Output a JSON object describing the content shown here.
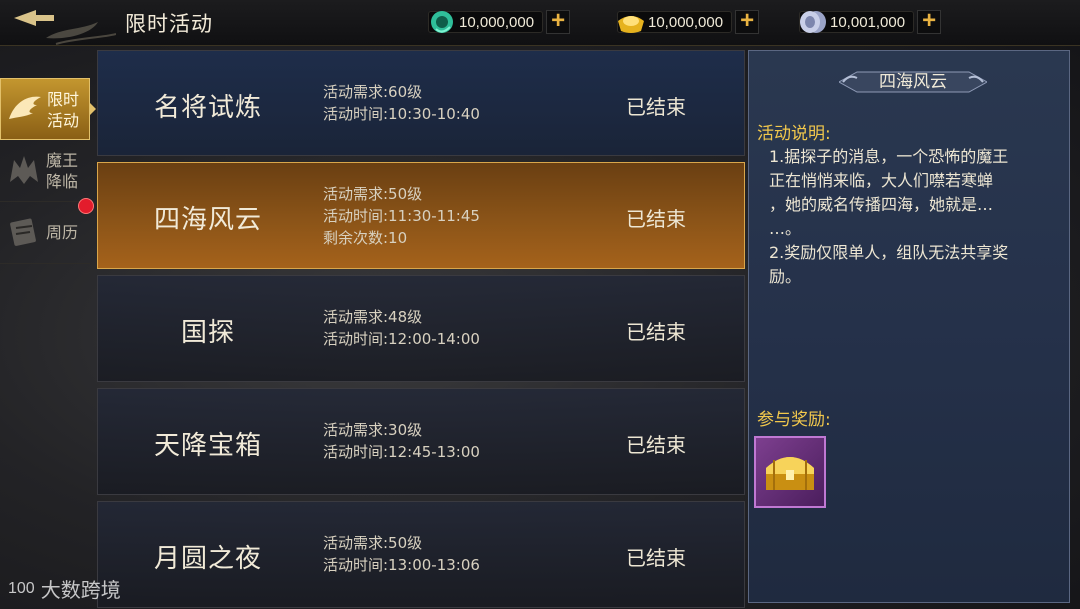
{
  "header": {
    "title": "限时活动",
    "currencies": [
      {
        "icon": "jade-coin-icon",
        "value": "10,000,000"
      },
      {
        "icon": "gold-ingot-icon",
        "value": "10,000,000"
      },
      {
        "icon": "silver-coin-icon",
        "value": "10,001,000"
      }
    ],
    "plus_label": "+"
  },
  "nav": [
    {
      "label": "限时\n活动",
      "icon": "wing-icon",
      "active": true
    },
    {
      "label": "魔王\n降临",
      "icon": "demon-icon",
      "active": false
    },
    {
      "label": "周历",
      "icon": "calendar-icon",
      "active": false,
      "badge": true
    }
  ],
  "activities": [
    {
      "name": "名将试炼",
      "lines": [
        "活动需求:60级",
        "活动时间:10:30-10:40"
      ],
      "status": "已结束"
    },
    {
      "name": "四海风云",
      "lines": [
        "活动需求:50级",
        "活动时间:11:30-11:45",
        "剩余次数:10"
      ],
      "status": "已结束"
    },
    {
      "name": "国探",
      "lines": [
        "活动需求:48级",
        "活动时间:12:00-14:00"
      ],
      "status": "已结束"
    },
    {
      "name": "天降宝箱",
      "lines": [
        "活动需求:30级",
        "活动时间:12:45-13:00"
      ],
      "status": "已结束"
    },
    {
      "name": "月圆之夜",
      "lines": [
        "活动需求:50级",
        "活动时间:13:00-13:06"
      ],
      "status": "已结束"
    }
  ],
  "detail": {
    "title": "四海风云",
    "desc_heading": "活动说明:",
    "desc_lines": [
      "1.据探子的消息，一个恐怖的魔王",
      "正在悄悄来临，大人们噤若寒蝉",
      "，她的威名传播四海，她就是…",
      "…。",
      "2.奖励仅限单人，组队无法共享奖",
      "励。"
    ],
    "reward_heading": "参与奖励:",
    "reward_icon": "treasure-chest-icon"
  },
  "watermark": {
    "logo": "100",
    "text": "大数跨境"
  },
  "colors": {
    "accent_gold": "#f2c84c",
    "selected_row": "#8b5418",
    "badge_red": "#e31c2c"
  }
}
